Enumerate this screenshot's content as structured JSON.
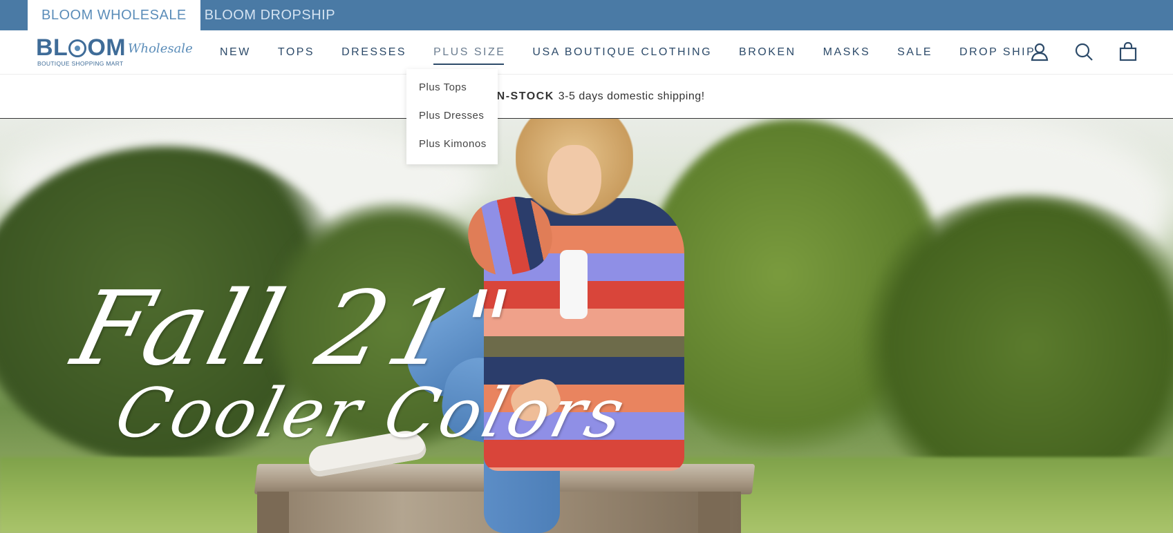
{
  "topbar": {
    "tabs": [
      {
        "label": "BLOOM WHOLESALE",
        "active": true
      },
      {
        "label": "BLOOM DROPSHIP",
        "active": false
      }
    ]
  },
  "logo": {
    "main_left": "BL",
    "main_right": "OM",
    "script": "Wholesale",
    "sub": "BOUTIQUE SHOPPING MART"
  },
  "nav": {
    "items": [
      {
        "label": "NEW"
      },
      {
        "label": "TOPS"
      },
      {
        "label": "DRESSES"
      },
      {
        "label": "PLUS SIZE",
        "active": true
      },
      {
        "label": "USA BOUTIQUE CLOTHING"
      },
      {
        "label": "BROKEN"
      },
      {
        "label": "MASKS"
      },
      {
        "label": "SALE"
      },
      {
        "label": "DROP SHIP"
      }
    ]
  },
  "header_icons": [
    "account-icon",
    "search-icon",
    "cart-icon"
  ],
  "announcement": {
    "strong": "ITE IN-STOCK",
    "text": "3-5 days domestic shipping!"
  },
  "dropdown": {
    "items": [
      {
        "label": "Plus Tops"
      },
      {
        "label": "Plus Dresses"
      },
      {
        "label": "Plus Kimonos"
      }
    ]
  },
  "hero": {
    "line1": "Fall 21\"",
    "line2": "Cooler Colors"
  },
  "colors": {
    "topbar_bg": "#4a7aa5",
    "brand": "#3f6c98",
    "nav_text": "#2c4a69"
  }
}
